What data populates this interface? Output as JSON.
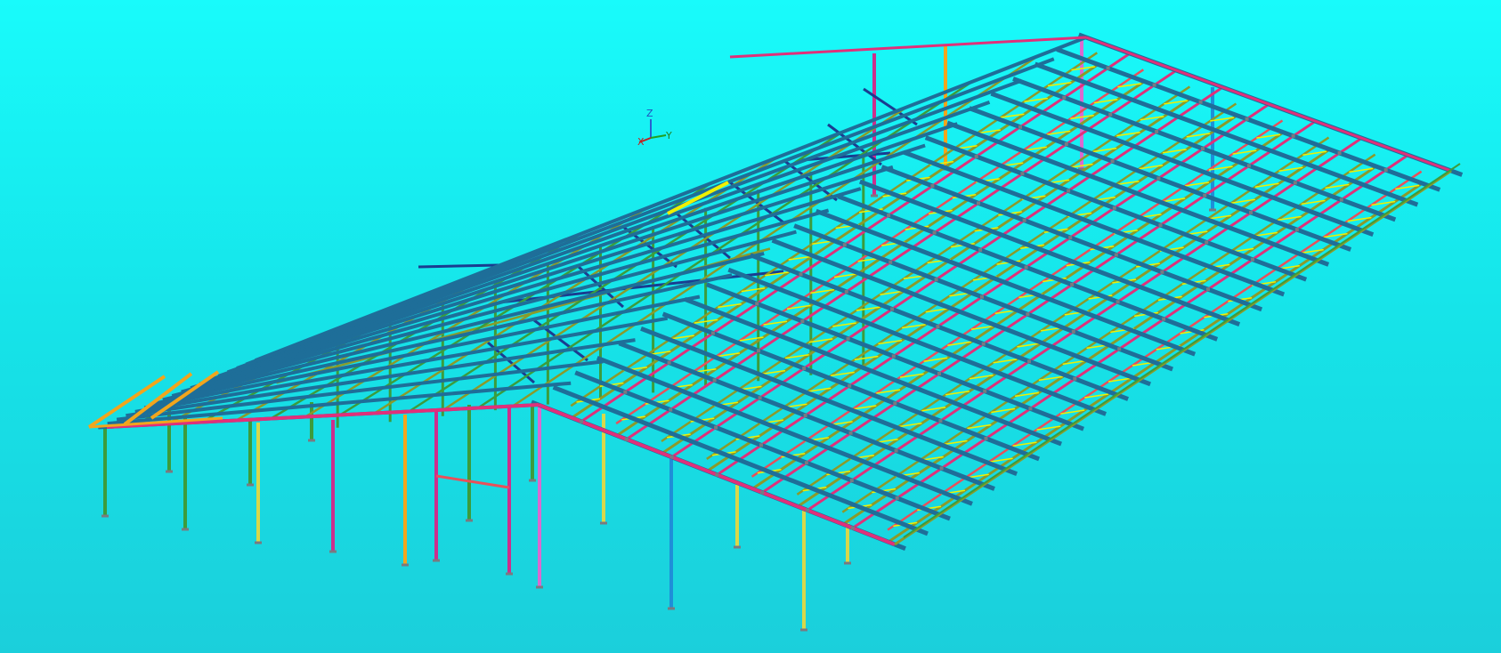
{
  "axis_triad": {
    "z_label": "Z",
    "x_label": "X",
    "y_label": "Y"
  },
  "colors": {
    "background_top": "#18fbfb",
    "background_bottom": "#1bcfdb",
    "purlin": "#1e6e99",
    "rafter": "#e0307a",
    "column_magenta": "#cc2f8c",
    "column_green": "#3c9c3c",
    "column_yellow": "#d8d84a",
    "column_orange": "#f2a51c",
    "column_blue": "#1e8fd8",
    "column_pink": "#d96ad0",
    "truss_chord": "#8c9a2a",
    "truss_web": "#f0f000",
    "truss_red": "#e8505a",
    "brace_navy": "#1a3c90",
    "node": "#7a7a80"
  },
  "icon": "axis-triad-icon"
}
